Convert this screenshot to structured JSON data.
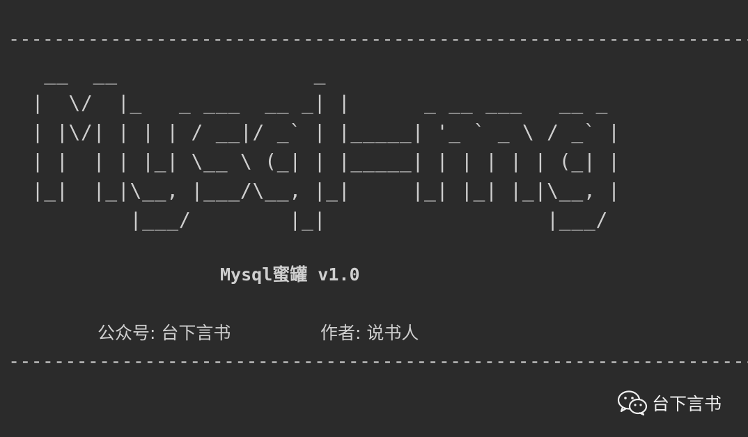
{
  "divider_text": "------------------------------------------------------------------------------------------------------------------------",
  "ascii_logo": "  __  __                _\n |  \\/  |_   _ ___  __ _| |      _ __ ___   __ _\n | |\\/| | | | / __|/ _` | |_____| '_ ` _ \\ / _` |\n | |  | | |_| \\__ \\ (_| | |_____| | | | | | (_| |\n |_|  |_|\\__, |___/\\__, |_|     |_| |_| |_|\\__, |\n         |___/        |_|                  |___/",
  "app_title": "Mysql蜜罐 v1.0",
  "credits": {
    "account": "公众号: 台下言书",
    "author": "作者: 说书人"
  },
  "watermark": {
    "icon": "wechat-icon",
    "text": "台下言书"
  }
}
